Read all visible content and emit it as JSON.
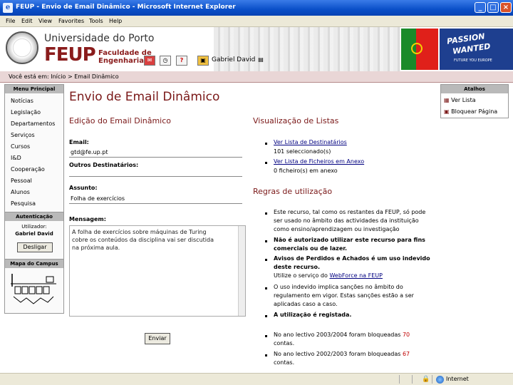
{
  "window": {
    "title": "FEUP - Envio de Email Dinâmico - Microsoft Internet Explorer",
    "minimize": "_",
    "maximize": "□",
    "close": "×"
  },
  "menu": [
    "File",
    "Edit",
    "View",
    "Favorites",
    "Tools",
    "Help"
  ],
  "header": {
    "university": "Universidade do Porto",
    "faculty_short": "FEUP",
    "faculty_line1": "Faculdade de",
    "faculty_line2": "Engenharia",
    "user": "Gabriel David",
    "promo_line1": "PASSION",
    "promo_line2": "WANTED",
    "promo_line3": "FUTURE YOU EUROPE"
  },
  "breadcrumb": "Você está em: Início > Email Dinâmico",
  "sidebar": {
    "menu_title": "Menu Principal",
    "items": [
      "Notícias",
      "Legislação",
      "Departamentos",
      "Serviços",
      "Cursos",
      "I&D",
      "Cooperação",
      "Pessoal",
      "Alunos",
      "Pesquisa"
    ],
    "auth_title": "Autenticação",
    "auth_user_label": "Utilizador:",
    "auth_user": "Gabriel David",
    "logout_label": "Desligar",
    "map_title": "Mapa do Campus"
  },
  "main": {
    "title": "Envio de Email Dinâmico",
    "edit_section": "Edição do Email Dinâmico",
    "email_label": "Email:",
    "email_value": "gtd@fe.up.pt",
    "others_label": "Outros Destinatários:",
    "subject_label": "Assunto:",
    "subject_value": "Folha de exercícios",
    "message_label": "Mensagem:",
    "message_lines": [
      "A folha de exercícios sobre máquinas de Turing",
      "cobre os conteúdos da disciplina vai ser discutida",
      "na próxima aula."
    ],
    "send_label": "Enviar"
  },
  "lists": {
    "title": "Visualização de Listas",
    "link1": "Ver Lista de Destinatários",
    "link1_sub": "101 seleccionado(s)",
    "link2": "Ver Lista de Ficheiros em Anexo",
    "link2_sub": "0 ficheiro(s) em anexo"
  },
  "rules": {
    "title": "Regras de utilização",
    "r1": [
      "Este recurso, tal como os restantes da FEUP, só pode",
      "ser usado no âmbito das actividades da instituição",
      "como ensino/aprendizagem ou investigação"
    ],
    "r2": [
      "Não é autorizado utilizar este recurso para fins",
      "comerciais ou de lazer."
    ],
    "r3": [
      "Avisos de Perdidos e Achados é um uso indevido",
      "deste recurso."
    ],
    "r3_link_prefix": "Utilize o serviço do ",
    "r3_link": "WebForce na FEUP",
    "r4": [
      "O uso indevido implica sanções no âmbito do",
      "regulamento em vigor. Estas sanções estão a ser",
      "aplicadas caso a caso."
    ],
    "r5": "A utilização é registada.",
    "r6_prefix": "No ano lectivo 2003/2004 foram bloqueadas ",
    "r6_num": "70",
    "r6_suffix": "contas.",
    "r7_prefix": "No ano lectivo 2002/2003 foram bloqueadas ",
    "r7_num": "67",
    "r7_suffix": "contas."
  },
  "shortcuts": {
    "title": "Atalhos",
    "items": [
      "Ver Lista",
      "Bloquear Página"
    ]
  },
  "status": {
    "zone": "Internet"
  }
}
